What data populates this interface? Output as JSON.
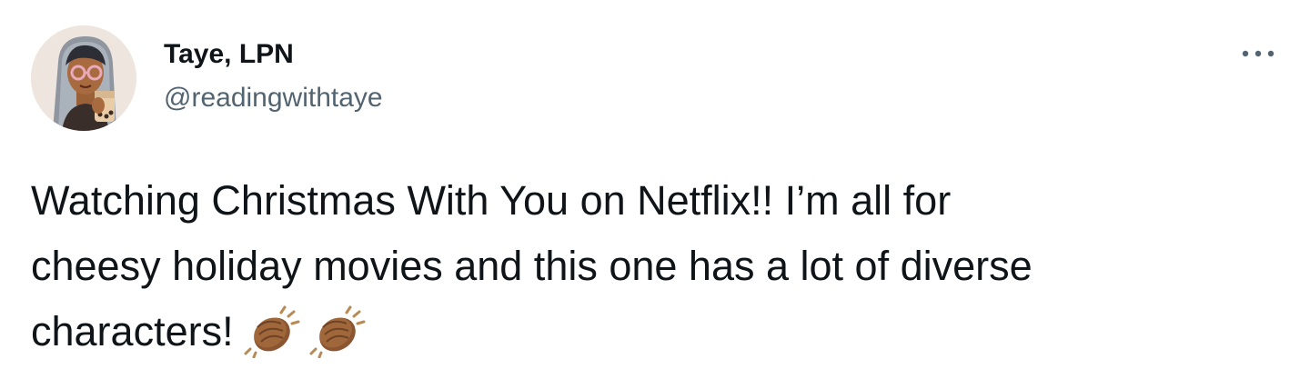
{
  "author": {
    "display_name": "Taye, LPN",
    "handle": "@readingwithtaye",
    "avatar_icon": "bitmoji-avatar"
  },
  "menu": {
    "more_icon": "more-horizontal-icon"
  },
  "tweet": {
    "text": "Watching Christmas With You on Netflix!! I’m all for\ncheesy holiday movies and this one has a lot of diverse\ncharacters!",
    "emojis": [
      "clapping-hands-medium-dark-skin",
      "clapping-hands-medium-dark-skin"
    ]
  },
  "colors": {
    "text_primary": "#0f1419",
    "text_secondary": "#536471",
    "background": "#ffffff",
    "emoji_skin": "#a0673b"
  }
}
